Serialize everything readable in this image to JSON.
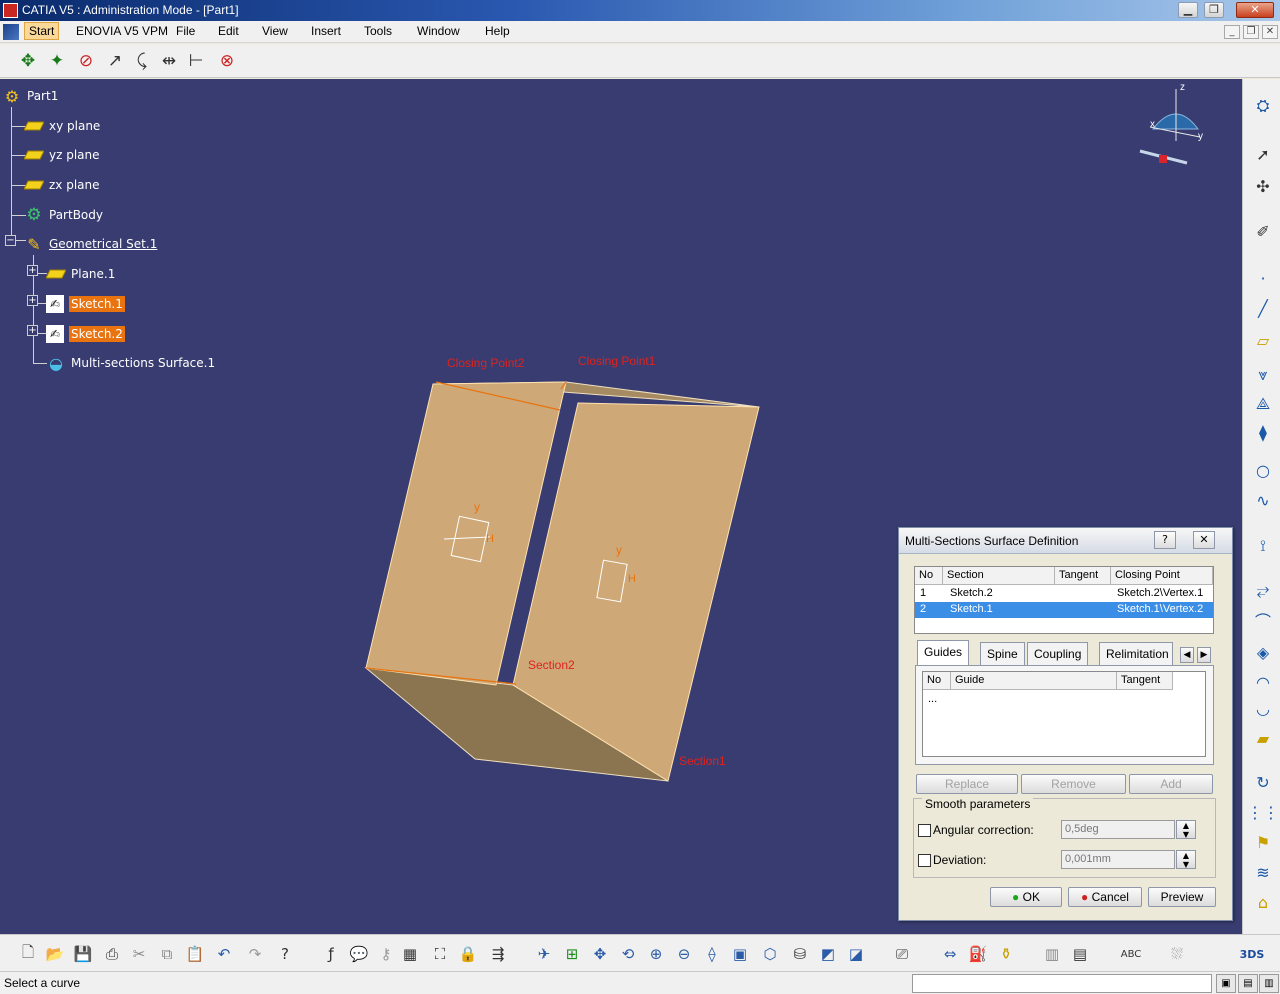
{
  "window": {
    "title": "CATIA V5 : Administration Mode - [Part1]",
    "min_icon": "minimize-icon",
    "max_icon": "maximize-icon",
    "close_icon": "close-icon"
  },
  "menubar": {
    "items": [
      "Start",
      "ENOVIA V5 VPM",
      "File",
      "Edit",
      "View",
      "Insert",
      "Tools",
      "Window",
      "Help"
    ]
  },
  "top_toolbar": {
    "icons": [
      "pan-icon",
      "rotate-icon",
      "no-show-icon",
      "snap-icon",
      "curve-icon",
      "mirror-icon",
      "measure-icon",
      "hide-icon"
    ]
  },
  "tree": {
    "root": "Part1",
    "nodes": [
      {
        "label": "xy plane",
        "icon": "plane-icon"
      },
      {
        "label": "yz plane",
        "icon": "plane-icon"
      },
      {
        "label": "zx plane",
        "icon": "plane-icon"
      },
      {
        "label": "PartBody",
        "icon": "gear-body-icon"
      },
      {
        "label": "Geometrical Set.1",
        "icon": "geometrical-set-icon"
      },
      {
        "label": "Plane.1",
        "icon": "plane-icon"
      },
      {
        "label": "Sketch.1",
        "icon": "sketch-icon"
      },
      {
        "label": "Sketch.2",
        "icon": "sketch-icon"
      },
      {
        "label": "Multi-sections Surface.1",
        "icon": "multi-section-icon"
      }
    ]
  },
  "annotations": {
    "closing_point_2": "Closing Point2",
    "closing_point_1": "Closing Point1",
    "section_2": "Section2",
    "section_1": "Section1"
  },
  "compass": {
    "z": "z",
    "x": "x",
    "y": "y"
  },
  "dialog": {
    "title": "Multi-Sections Surface Definition",
    "help_label": "?",
    "close_label": "✕",
    "sections_table": {
      "headers": [
        "No",
        "Section",
        "Tangent",
        "Closing Point"
      ],
      "rows": [
        {
          "no": "1",
          "section": "Sketch.2",
          "tangent": "",
          "closing_point": "Sketch.2\\Vertex.1",
          "selected": false
        },
        {
          "no": "2",
          "section": "Sketch.1",
          "tangent": "",
          "closing_point": "Sketch.1\\Vertex.2",
          "selected": true
        }
      ]
    },
    "tabs": [
      "Guides",
      "Spine",
      "Coupling",
      "Relimitation"
    ],
    "active_tab": "Guides",
    "guides_table": {
      "headers": [
        "No",
        "Guide",
        "Tangent"
      ],
      "rows": [
        {
          "no": "...",
          "guide": "",
          "tangent": ""
        }
      ]
    },
    "buttons": {
      "replace": "Replace",
      "remove": "Remove",
      "add": "Add"
    },
    "smooth": {
      "legend": "Smooth parameters",
      "angular_label": "Angular correction:",
      "angular_value": "0,5deg",
      "deviation_label": "Deviation:",
      "deviation_value": "0,001mm"
    },
    "ok": "OK",
    "cancel": "Cancel",
    "preview": "Preview"
  },
  "status": {
    "message": "Select a curve"
  },
  "colors": {
    "viewport_bg": "#383c70",
    "surface": "#cfa877",
    "surface_dark": "#8b7450",
    "selection": "#e8730f",
    "annotation": "#e0221c",
    "list_selection": "#3a8ee6"
  }
}
